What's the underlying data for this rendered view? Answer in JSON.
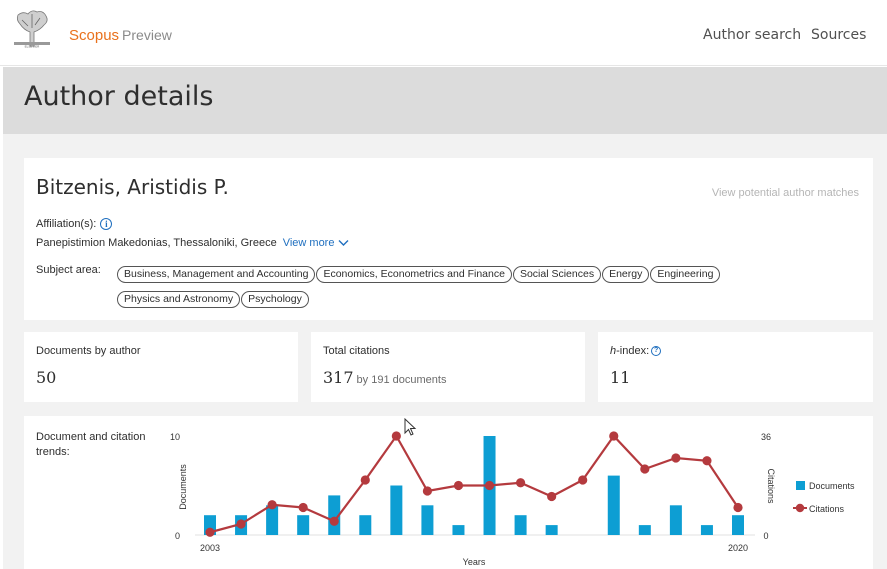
{
  "header": {
    "brand": "Scopus",
    "brand_sub": "Preview",
    "nav": {
      "author_search": "Author search",
      "sources": "Sources"
    }
  },
  "page_title": "Author details",
  "profile": {
    "name": "Bitzenis, Aristidis P.",
    "potential_matches": "View potential author matches",
    "affiliation_label": "Affiliation(s):",
    "affiliation": "Panepistimion Makedonias, Thessaloniki, Greece",
    "view_more": "View more",
    "subject_label": "Subject area:",
    "subjects": [
      "Business, Management and Accounting",
      "Economics, Econometrics and Finance",
      "Social Sciences",
      "Energy",
      "Engineering",
      "Physics and Astronomy",
      "Psychology"
    ]
  },
  "metrics": {
    "documents_label": "Documents by author",
    "documents_value": "50",
    "citations_label": "Total citations",
    "citations_value": "317",
    "citations_sub": "by 191 documents",
    "hindex_label": "-index:",
    "hindex_letter": "h",
    "hindex_value": "11"
  },
  "chart_data": {
    "type": "bar",
    "title": "Document and citation trends:",
    "xlabel": "Years",
    "ylabel_left": "Documents",
    "ylabel_right": "Citations",
    "x_start_label": "2003",
    "x_end_label": "2020",
    "categories": [
      "2003",
      "2004",
      "2005",
      "2006",
      "2007",
      "2008",
      "2009",
      "2010",
      "2011",
      "2012",
      "2013",
      "2014",
      "2015",
      "2016",
      "2017",
      "2018",
      "2019",
      "2020"
    ],
    "left_ticks": [
      "0",
      "10"
    ],
    "right_ticks": [
      "0",
      "36"
    ],
    "ylim_left": [
      0,
      10
    ],
    "ylim_right": [
      0,
      36
    ],
    "series": [
      {
        "name": "Documents",
        "kind": "bar",
        "color": "#0d9ed3",
        "values": [
          2,
          2,
          3,
          2,
          4,
          2,
          5,
          3,
          1,
          10,
          2,
          1,
          0,
          6,
          1,
          3,
          1,
          2
        ]
      },
      {
        "name": "Citations",
        "kind": "line",
        "color": "#b43a3e",
        "values": [
          1,
          4,
          11,
          10,
          5,
          20,
          36,
          16,
          18,
          18,
          19,
          14,
          20,
          36,
          24,
          28,
          27,
          10
        ]
      }
    ],
    "legend": "right"
  }
}
